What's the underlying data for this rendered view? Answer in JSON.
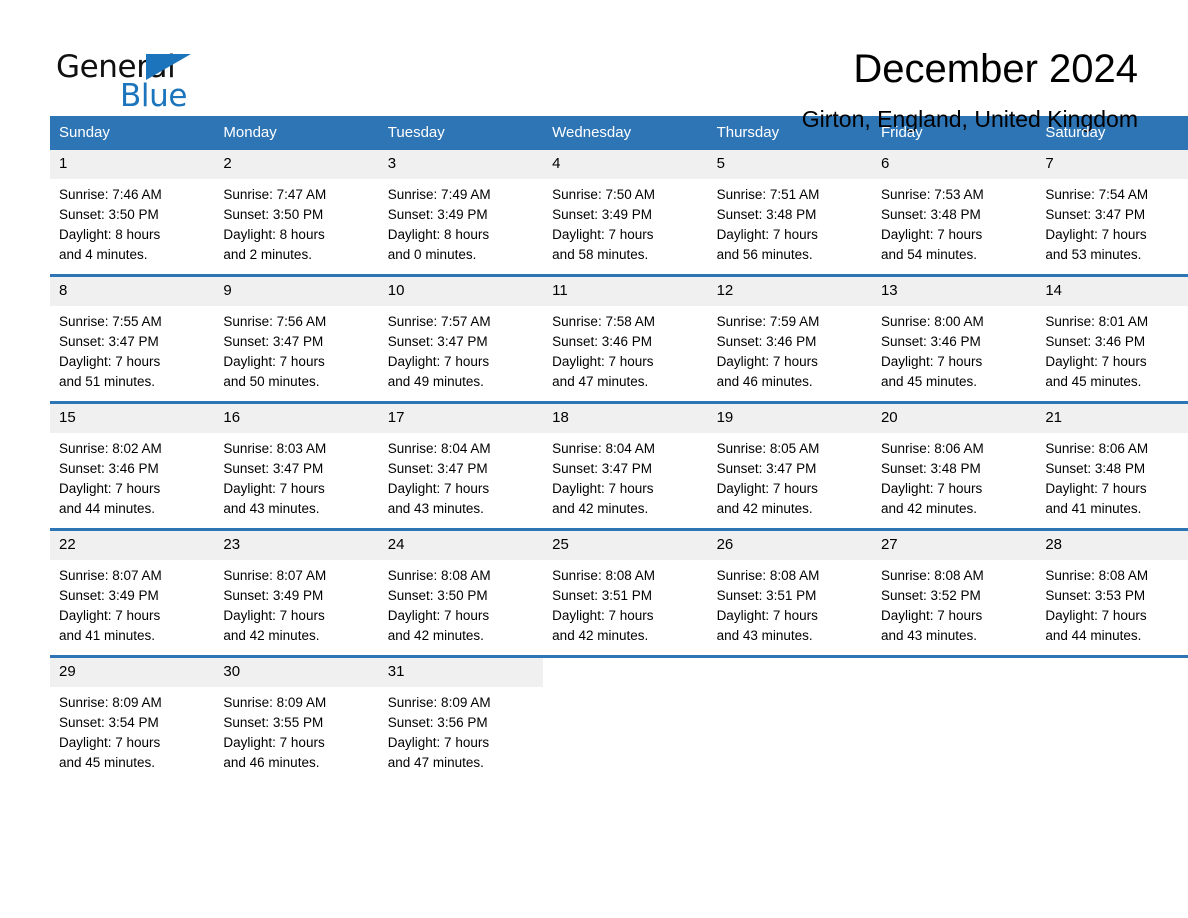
{
  "brand": {
    "word_general": "General",
    "word_blue": "Blue",
    "accent_color": "#1c75bc"
  },
  "header": {
    "title": "December 2024",
    "subtitle": "Girton, England, United Kingdom"
  },
  "theme": {
    "header_bg": "#2e75b6",
    "daynum_bg": "#f0f0f0",
    "page_bg": "#ffffff"
  },
  "labels": {
    "sunrise_prefix": "Sunrise:",
    "sunset_prefix": "Sunset:",
    "daylight_prefix": "Daylight:"
  },
  "weekday_headers": [
    "Sunday",
    "Monday",
    "Tuesday",
    "Wednesday",
    "Thursday",
    "Friday",
    "Saturday"
  ],
  "weeks": [
    [
      {
        "day": "1",
        "sunrise": "Sunrise: 7:46 AM",
        "sunset": "Sunset: 3:50 PM",
        "daylight_line1": "Daylight: 8 hours",
        "daylight_line2": "and 4 minutes."
      },
      {
        "day": "2",
        "sunrise": "Sunrise: 7:47 AM",
        "sunset": "Sunset: 3:50 PM",
        "daylight_line1": "Daylight: 8 hours",
        "daylight_line2": "and 2 minutes."
      },
      {
        "day": "3",
        "sunrise": "Sunrise: 7:49 AM",
        "sunset": "Sunset: 3:49 PM",
        "daylight_line1": "Daylight: 8 hours",
        "daylight_line2": "and 0 minutes."
      },
      {
        "day": "4",
        "sunrise": "Sunrise: 7:50 AM",
        "sunset": "Sunset: 3:49 PM",
        "daylight_line1": "Daylight: 7 hours",
        "daylight_line2": "and 58 minutes."
      },
      {
        "day": "5",
        "sunrise": "Sunrise: 7:51 AM",
        "sunset": "Sunset: 3:48 PM",
        "daylight_line1": "Daylight: 7 hours",
        "daylight_line2": "and 56 minutes."
      },
      {
        "day": "6",
        "sunrise": "Sunrise: 7:53 AM",
        "sunset": "Sunset: 3:48 PM",
        "daylight_line1": "Daylight: 7 hours",
        "daylight_line2": "and 54 minutes."
      },
      {
        "day": "7",
        "sunrise": "Sunrise: 7:54 AM",
        "sunset": "Sunset: 3:47 PM",
        "daylight_line1": "Daylight: 7 hours",
        "daylight_line2": "and 53 minutes."
      }
    ],
    [
      {
        "day": "8",
        "sunrise": "Sunrise: 7:55 AM",
        "sunset": "Sunset: 3:47 PM",
        "daylight_line1": "Daylight: 7 hours",
        "daylight_line2": "and 51 minutes."
      },
      {
        "day": "9",
        "sunrise": "Sunrise: 7:56 AM",
        "sunset": "Sunset: 3:47 PM",
        "daylight_line1": "Daylight: 7 hours",
        "daylight_line2": "and 50 minutes."
      },
      {
        "day": "10",
        "sunrise": "Sunrise: 7:57 AM",
        "sunset": "Sunset: 3:47 PM",
        "daylight_line1": "Daylight: 7 hours",
        "daylight_line2": "and 49 minutes."
      },
      {
        "day": "11",
        "sunrise": "Sunrise: 7:58 AM",
        "sunset": "Sunset: 3:46 PM",
        "daylight_line1": "Daylight: 7 hours",
        "daylight_line2": "and 47 minutes."
      },
      {
        "day": "12",
        "sunrise": "Sunrise: 7:59 AM",
        "sunset": "Sunset: 3:46 PM",
        "daylight_line1": "Daylight: 7 hours",
        "daylight_line2": "and 46 minutes."
      },
      {
        "day": "13",
        "sunrise": "Sunrise: 8:00 AM",
        "sunset": "Sunset: 3:46 PM",
        "daylight_line1": "Daylight: 7 hours",
        "daylight_line2": "and 45 minutes."
      },
      {
        "day": "14",
        "sunrise": "Sunrise: 8:01 AM",
        "sunset": "Sunset: 3:46 PM",
        "daylight_line1": "Daylight: 7 hours",
        "daylight_line2": "and 45 minutes."
      }
    ],
    [
      {
        "day": "15",
        "sunrise": "Sunrise: 8:02 AM",
        "sunset": "Sunset: 3:46 PM",
        "daylight_line1": "Daylight: 7 hours",
        "daylight_line2": "and 44 minutes."
      },
      {
        "day": "16",
        "sunrise": "Sunrise: 8:03 AM",
        "sunset": "Sunset: 3:47 PM",
        "daylight_line1": "Daylight: 7 hours",
        "daylight_line2": "and 43 minutes."
      },
      {
        "day": "17",
        "sunrise": "Sunrise: 8:04 AM",
        "sunset": "Sunset: 3:47 PM",
        "daylight_line1": "Daylight: 7 hours",
        "daylight_line2": "and 43 minutes."
      },
      {
        "day": "18",
        "sunrise": "Sunrise: 8:04 AM",
        "sunset": "Sunset: 3:47 PM",
        "daylight_line1": "Daylight: 7 hours",
        "daylight_line2": "and 42 minutes."
      },
      {
        "day": "19",
        "sunrise": "Sunrise: 8:05 AM",
        "sunset": "Sunset: 3:47 PM",
        "daylight_line1": "Daylight: 7 hours",
        "daylight_line2": "and 42 minutes."
      },
      {
        "day": "20",
        "sunrise": "Sunrise: 8:06 AM",
        "sunset": "Sunset: 3:48 PM",
        "daylight_line1": "Daylight: 7 hours",
        "daylight_line2": "and 42 minutes."
      },
      {
        "day": "21",
        "sunrise": "Sunrise: 8:06 AM",
        "sunset": "Sunset: 3:48 PM",
        "daylight_line1": "Daylight: 7 hours",
        "daylight_line2": "and 41 minutes."
      }
    ],
    [
      {
        "day": "22",
        "sunrise": "Sunrise: 8:07 AM",
        "sunset": "Sunset: 3:49 PM",
        "daylight_line1": "Daylight: 7 hours",
        "daylight_line2": "and 41 minutes."
      },
      {
        "day": "23",
        "sunrise": "Sunrise: 8:07 AM",
        "sunset": "Sunset: 3:49 PM",
        "daylight_line1": "Daylight: 7 hours",
        "daylight_line2": "and 42 minutes."
      },
      {
        "day": "24",
        "sunrise": "Sunrise: 8:08 AM",
        "sunset": "Sunset: 3:50 PM",
        "daylight_line1": "Daylight: 7 hours",
        "daylight_line2": "and 42 minutes."
      },
      {
        "day": "25",
        "sunrise": "Sunrise: 8:08 AM",
        "sunset": "Sunset: 3:51 PM",
        "daylight_line1": "Daylight: 7 hours",
        "daylight_line2": "and 42 minutes."
      },
      {
        "day": "26",
        "sunrise": "Sunrise: 8:08 AM",
        "sunset": "Sunset: 3:51 PM",
        "daylight_line1": "Daylight: 7 hours",
        "daylight_line2": "and 43 minutes."
      },
      {
        "day": "27",
        "sunrise": "Sunrise: 8:08 AM",
        "sunset": "Sunset: 3:52 PM",
        "daylight_line1": "Daylight: 7 hours",
        "daylight_line2": "and 43 minutes."
      },
      {
        "day": "28",
        "sunrise": "Sunrise: 8:08 AM",
        "sunset": "Sunset: 3:53 PM",
        "daylight_line1": "Daylight: 7 hours",
        "daylight_line2": "and 44 minutes."
      }
    ],
    [
      {
        "day": "29",
        "sunrise": "Sunrise: 8:09 AM",
        "sunset": "Sunset: 3:54 PM",
        "daylight_line1": "Daylight: 7 hours",
        "daylight_line2": "and 45 minutes."
      },
      {
        "day": "30",
        "sunrise": "Sunrise: 8:09 AM",
        "sunset": "Sunset: 3:55 PM",
        "daylight_line1": "Daylight: 7 hours",
        "daylight_line2": "and 46 minutes."
      },
      {
        "day": "31",
        "sunrise": "Sunrise: 8:09 AM",
        "sunset": "Sunset: 3:56 PM",
        "daylight_line1": "Daylight: 7 hours",
        "daylight_line2": "and 47 minutes."
      },
      {
        "day": "",
        "sunrise": "",
        "sunset": "",
        "daylight_line1": "",
        "daylight_line2": ""
      },
      {
        "day": "",
        "sunrise": "",
        "sunset": "",
        "daylight_line1": "",
        "daylight_line2": ""
      },
      {
        "day": "",
        "sunrise": "",
        "sunset": "",
        "daylight_line1": "",
        "daylight_line2": ""
      },
      {
        "day": "",
        "sunrise": "",
        "sunset": "",
        "daylight_line1": "",
        "daylight_line2": ""
      }
    ]
  ]
}
